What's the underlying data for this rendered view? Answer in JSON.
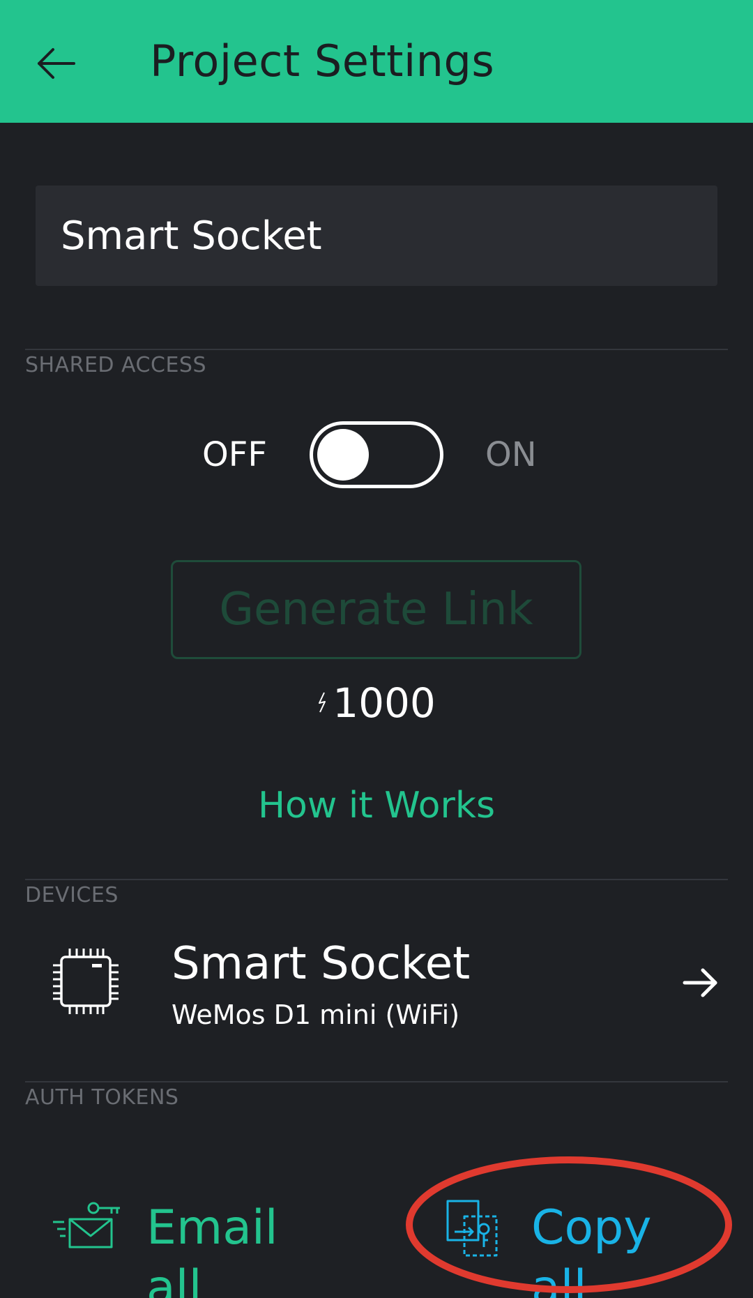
{
  "header": {
    "title": "Project Settings",
    "background_color": "#23c48e",
    "back_icon": "arrow-left-icon"
  },
  "project": {
    "name": "Smart Socket"
  },
  "shared_access": {
    "section_label": "SHARED ACCESS",
    "toggle_off_label": "OFF",
    "toggle_on_label": "ON",
    "toggle_state": "off",
    "generate_link_label": "Generate Link",
    "energy_cost": "1000",
    "energy_icon": "lightning-icon",
    "how_it_works_label": "How it Works"
  },
  "devices": {
    "section_label": "DEVICES",
    "items": [
      {
        "name": "Smart Socket",
        "model": "WeMos D1 mini (WiFi)",
        "icon": "chip-icon",
        "action_icon": "arrow-right-icon"
      }
    ]
  },
  "auth_tokens": {
    "section_label": "AUTH TOKENS",
    "email_all_label": "Email all",
    "email_icon": "email-key-icon",
    "copy_all_label": "Copy all",
    "copy_icon": "copy-key-icon"
  },
  "colors": {
    "accent_green": "#23c48e",
    "accent_blue": "#19b3e6",
    "background": "#1e2024",
    "highlight_red": "#e03a2f"
  }
}
